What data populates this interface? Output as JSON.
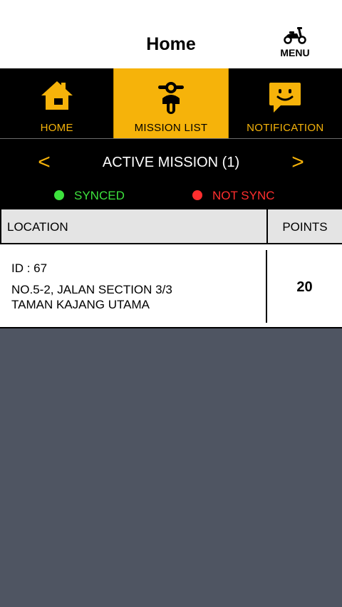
{
  "header": {
    "title": "Home",
    "menu_label": "MENU",
    "menu_icon": "scooter-icon"
  },
  "tabs": [
    {
      "label": "HOME",
      "icon": "house-icon",
      "active": false
    },
    {
      "label": "MISSION LIST",
      "icon": "scooter-rider-icon",
      "active": true
    },
    {
      "label": "NOTIFICATION",
      "icon": "chat-smile-icon",
      "active": false
    }
  ],
  "mission": {
    "title": "ACTIVE MISSION (1)",
    "prev": "<",
    "next": ">"
  },
  "legend": {
    "synced": "SYNCED",
    "not_sync": "NOT SYNC"
  },
  "table": {
    "headers": {
      "location": "LOCATION",
      "points": "POINTS"
    },
    "rows": [
      {
        "id": "ID : 67",
        "address_line1": "NO.5-2, JALAN SECTION 3/3",
        "address_line2": "TAMAN KAJANG UTAMA",
        "points": "20"
      }
    ]
  },
  "colors": {
    "accent": "#f6b30a",
    "synced": "#3de23d",
    "not_sync": "#ff2e2e",
    "background": "#4f5562"
  }
}
